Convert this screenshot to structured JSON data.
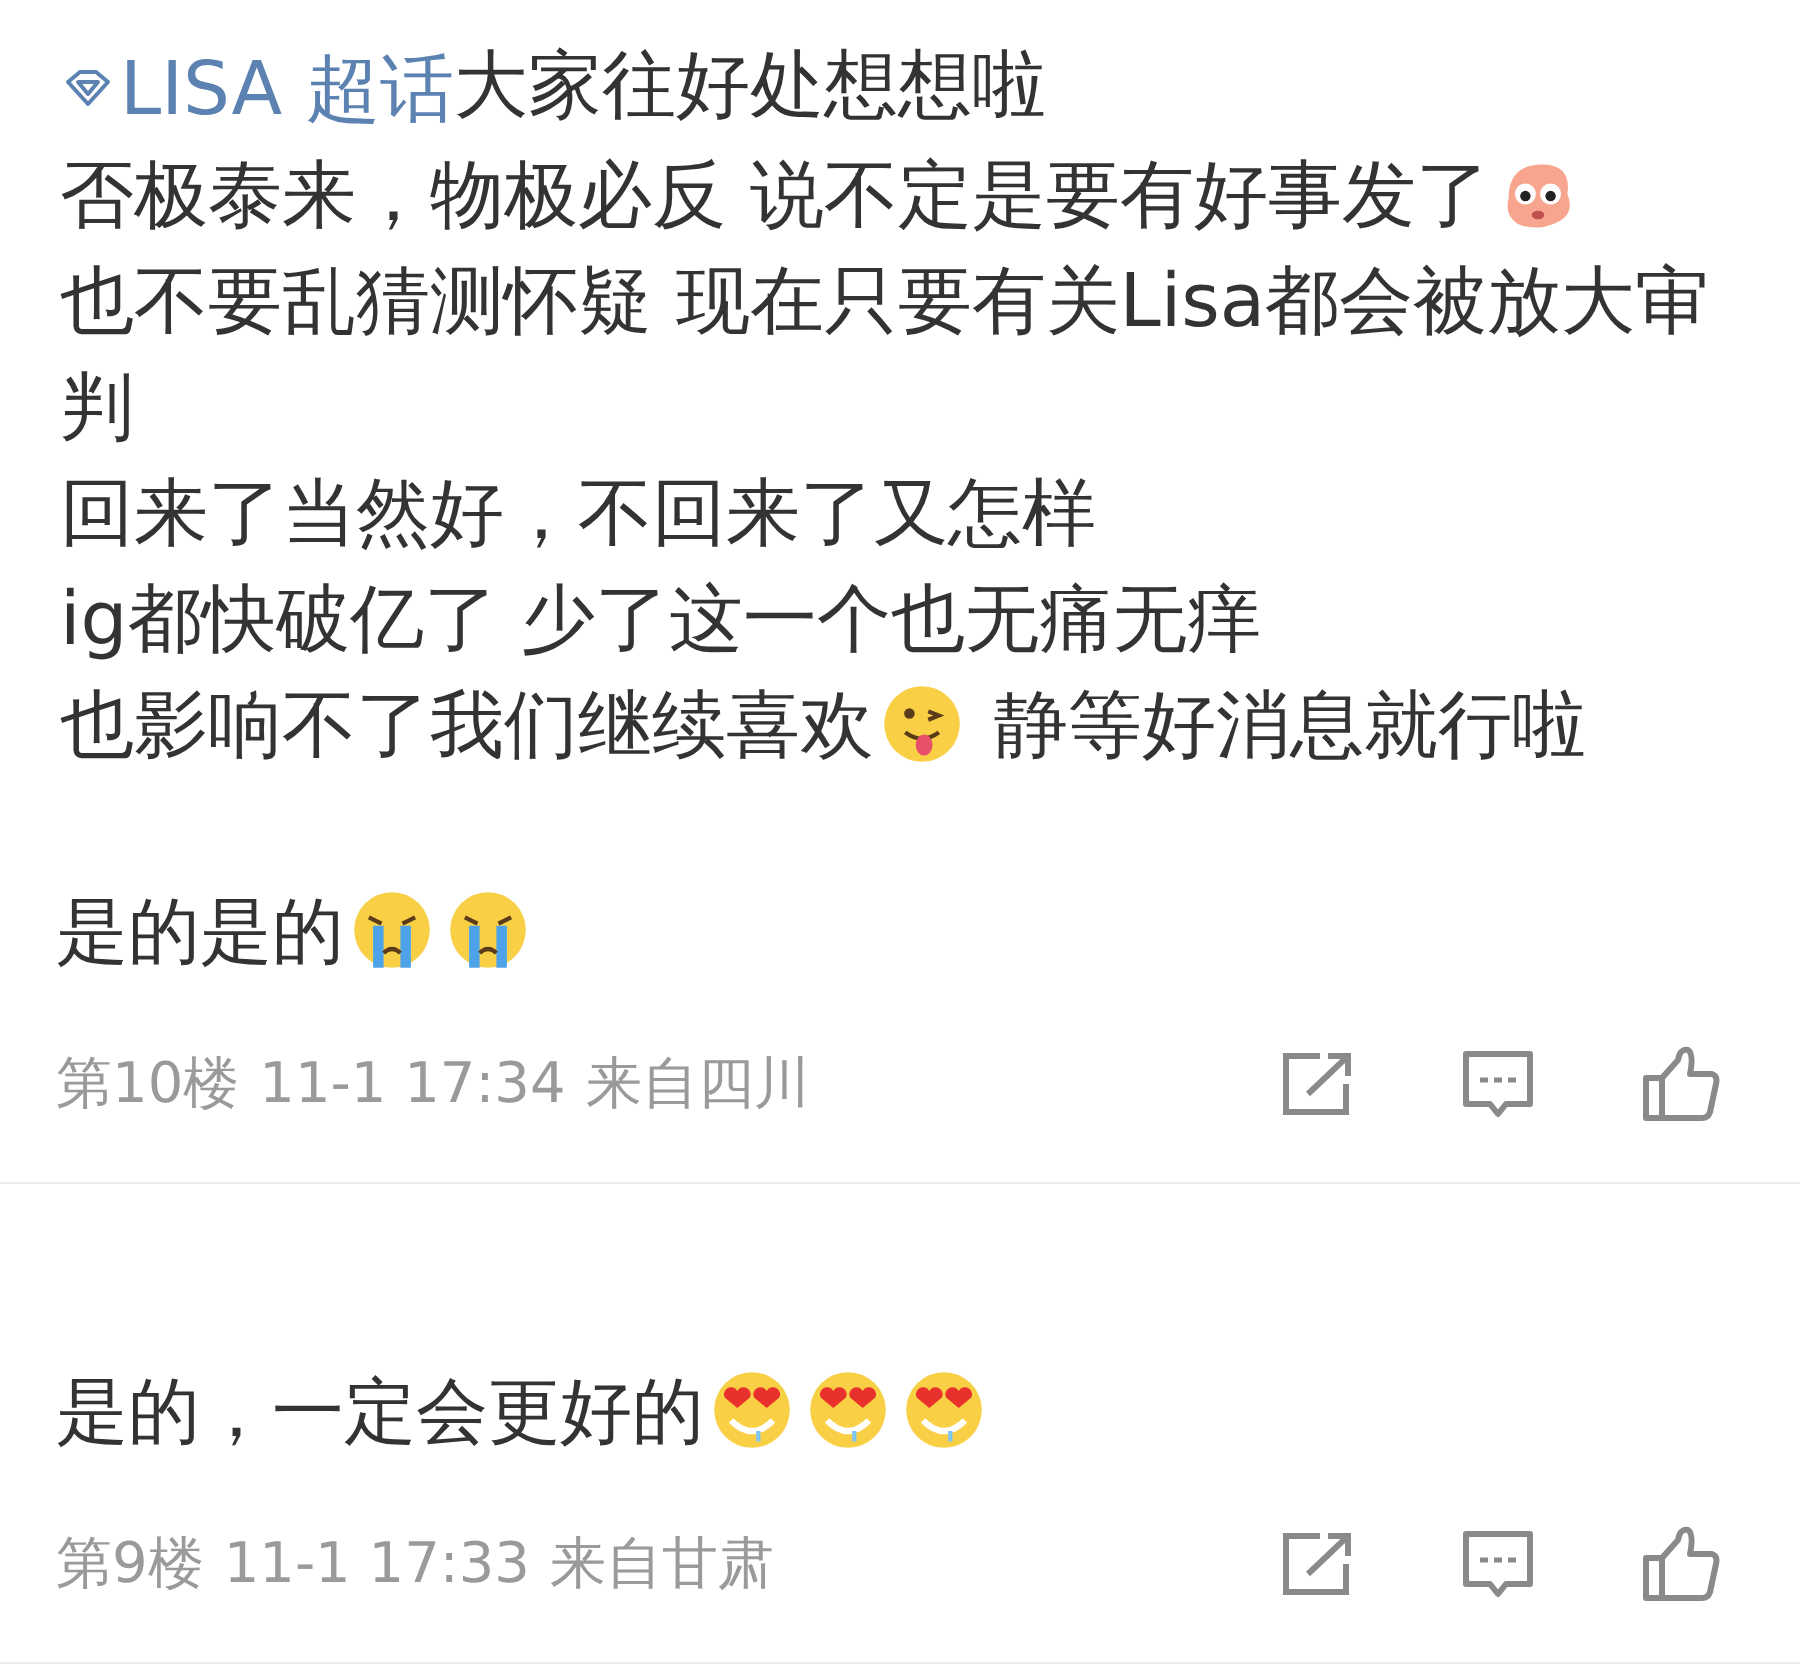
{
  "post": {
    "lines": [
      [
        {
          "kind": "tag",
          "text": "LISA 超话"
        },
        {
          "kind": "text",
          "text": "大家往好处想想啦"
        }
      ],
      [
        {
          "kind": "text",
          "text": "否极泰来，物极必反 说不定是要有好事发了"
        },
        {
          "kind": "creature-emoji"
        }
      ],
      [
        {
          "kind": "text",
          "text": "也不要乱猜测怀疑 现在只要有关Lisa都会被放大审判"
        }
      ],
      [
        {
          "kind": "text",
          "text": "回来了当然好，不回来了又怎样"
        }
      ],
      [
        {
          "kind": "text",
          "text": "ig都快破亿了 少了这一个也无痛无痒"
        }
      ],
      [
        {
          "kind": "text",
          "text": "也影响不了我们继续喜欢"
        },
        {
          "kind": "tongue-emoji"
        },
        {
          "kind": "text",
          "text": " 静等好消息就行啦"
        }
      ]
    ]
  },
  "comments": [
    {
      "segments": [
        {
          "kind": "text",
          "text": "是的是的"
        },
        {
          "kind": "crying-emoji"
        },
        {
          "kind": "crying-emoji"
        }
      ],
      "floor": "第10楼",
      "time": "11-1 17:34",
      "location": "来自四川"
    },
    {
      "segments": [
        {
          "kind": "text",
          "text": "是的，一定会更好的"
        },
        {
          "kind": "heart-eyes-emoji"
        },
        {
          "kind": "heart-eyes-emoji"
        },
        {
          "kind": "heart-eyes-emoji"
        }
      ],
      "floor": "第9楼",
      "time": "11-1 17:33",
      "location": "来自甘肃"
    }
  ]
}
